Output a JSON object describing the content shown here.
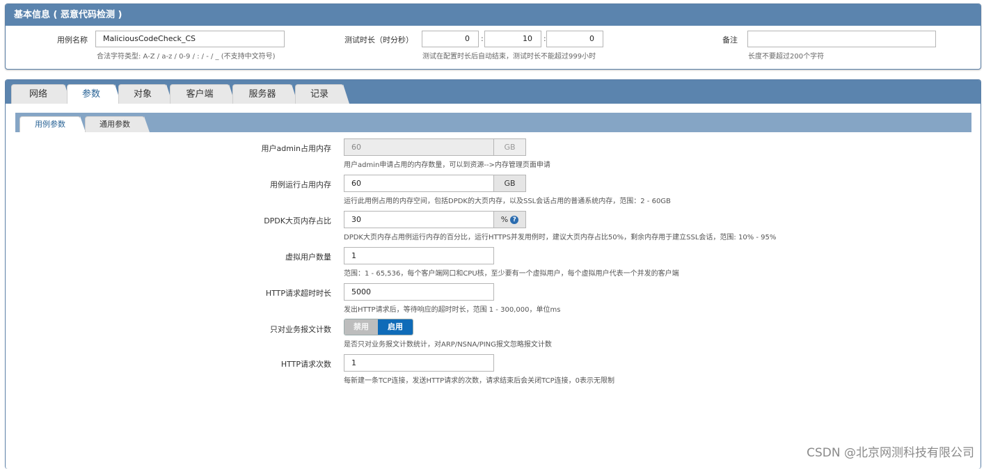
{
  "basic_info": {
    "title": "基本信息 ( 恶意代码检测 )",
    "case_name": {
      "label": "用例名称",
      "value": "MaliciousCodeCheck_CS",
      "hint": "合法字符类型: A-Z / a-z / 0-9 / : / - / _ (不支持中文符号)"
    },
    "duration": {
      "label": "测试时长（时分秒）",
      "hours": "0",
      "minutes": "10",
      "seconds": "0",
      "separator": ":",
      "hint": "测试在配置时长后自动结束，测试时长不能超过999小时"
    },
    "remark": {
      "label": "备注",
      "value": "",
      "hint": "长度不要超过200个字符"
    }
  },
  "tabs": [
    {
      "label": "网络",
      "active": false
    },
    {
      "label": "参数",
      "active": true
    },
    {
      "label": "对象",
      "active": false
    },
    {
      "label": "客户端",
      "active": false
    },
    {
      "label": "服务器",
      "active": false
    },
    {
      "label": "记录",
      "active": false
    }
  ],
  "subtabs": [
    {
      "label": "用例参数",
      "active": true
    },
    {
      "label": "通用参数",
      "active": false
    }
  ],
  "params": {
    "admin_memory": {
      "label": "用户admin占用内存",
      "value": "60",
      "unit": "GB",
      "hint": "用户admin申请占用的内存数量，可以到资源-->内存管理页面申请"
    },
    "case_memory": {
      "label": "用例运行占用内存",
      "value": "60",
      "unit": "GB",
      "hint": "运行此用例占用的内存空间，包括DPDK的大页内存，以及SSL会话占用的普通系统内存，范围：2 - 60GB"
    },
    "dpdk_ratio": {
      "label": "DPDK大页内存占比",
      "value": "30",
      "unit": "%",
      "help_icon": "question-circle-icon",
      "hint": "DPDK大页内存占用例运行内存的百分比，运行HTTPS并发用例时，建议大页内存占比50%，剩余内存用于建立SSL会话，范围: 10% - 95%"
    },
    "virtual_users": {
      "label": "虚拟用户数量",
      "value": "1",
      "hint": "范围：1 - 65,536，每个客户端网口和CPU核，至少要有一个虚拟用户，每个虚拟用户代表一个并发的客户端"
    },
    "http_timeout": {
      "label": "HTTP请求超时时长",
      "value": "5000",
      "hint": "发出HTTP请求后，等待响应的超时时长，范围 1 - 300,000，单位ms"
    },
    "business_only": {
      "label": "只对业务报文计数",
      "off_label": "禁用",
      "on_label": "启用",
      "state": "启用",
      "hint": "是否只对业务报文计数统计，对ARP/NSNA/PING报文忽略报文计数"
    },
    "http_requests": {
      "label": "HTTP请求次数",
      "value": "1",
      "hint": "每新建一条TCP连接，发送HTTP请求的次数，请求结束后会关闭TCP连接，0表示无限制"
    }
  },
  "watermark": "CSDN @北京网测科技有限公司",
  "colors": {
    "header_blue": "#5b84ae",
    "subtab_bar": "#85a5c5",
    "toggle_on": "#0f6bb8"
  }
}
